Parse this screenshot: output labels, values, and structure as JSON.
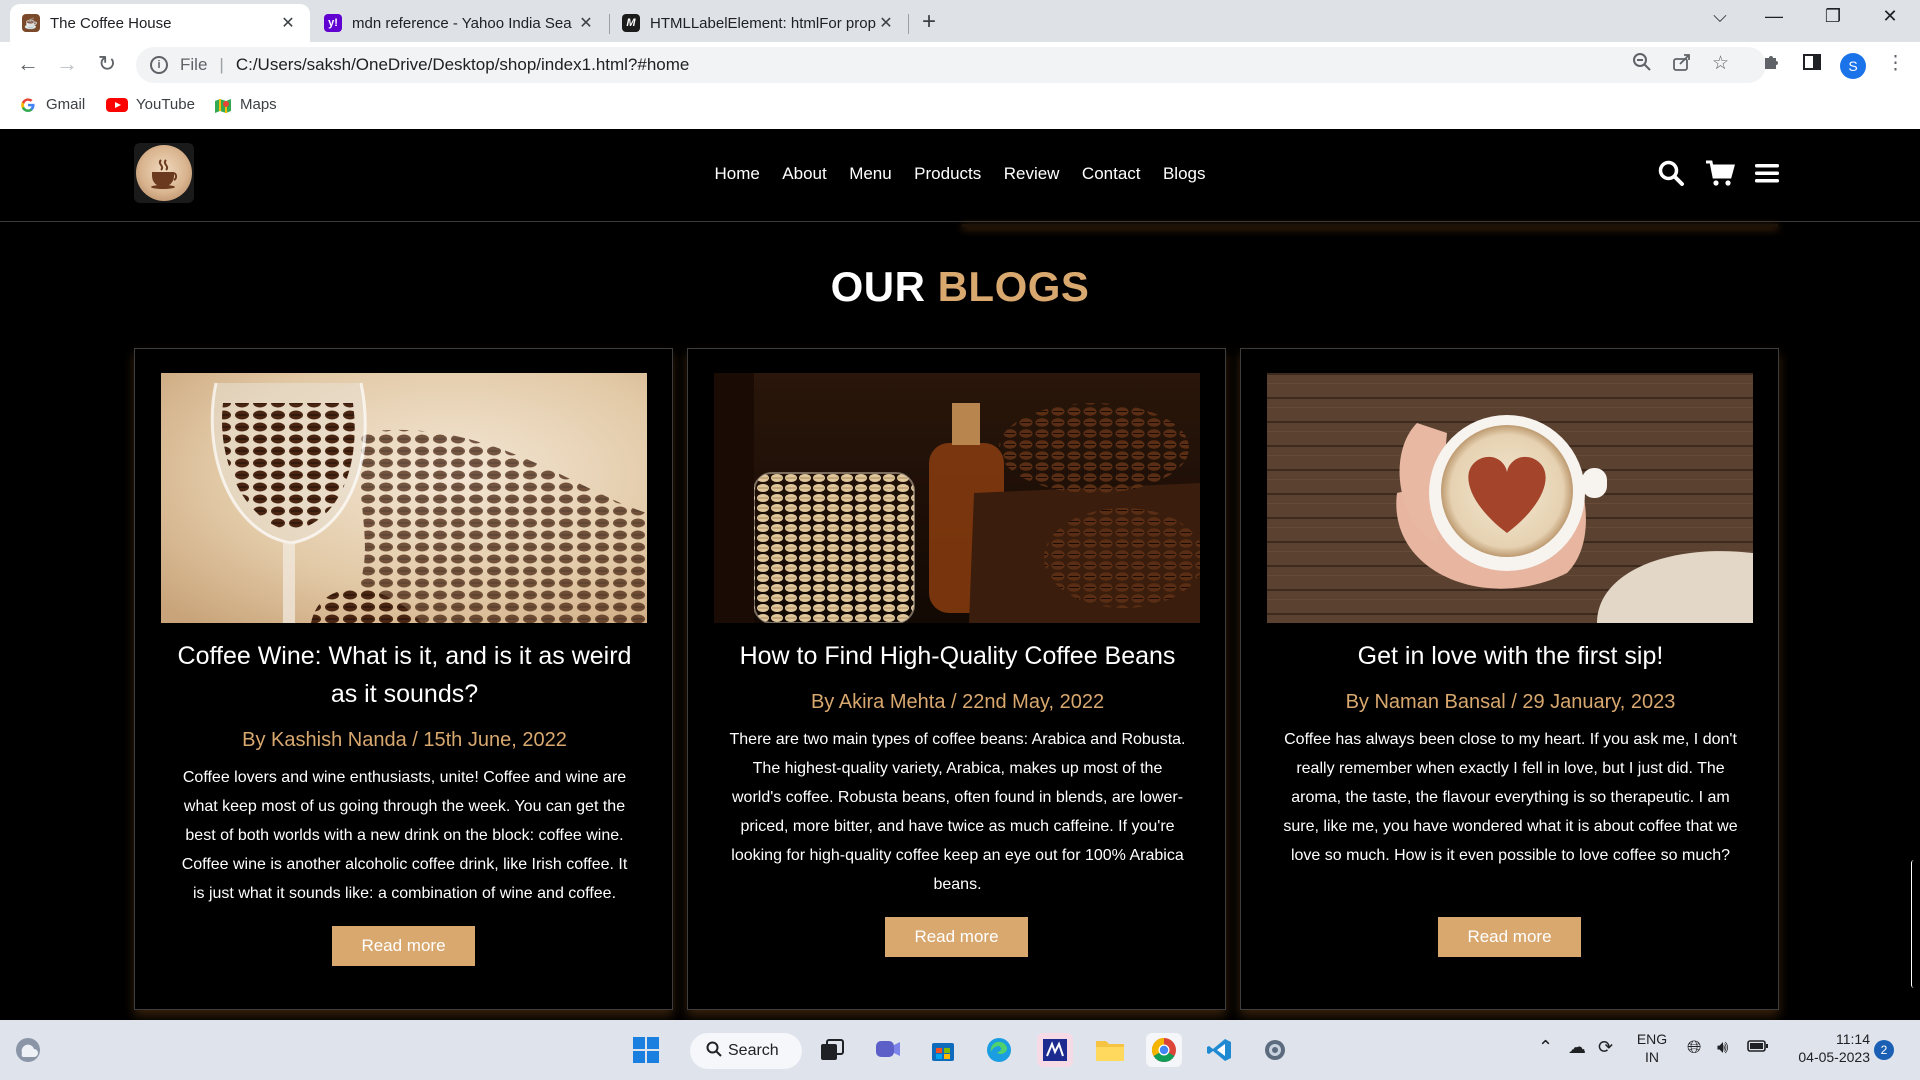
{
  "browser": {
    "tabs": [
      {
        "title": "The Coffee House",
        "active": true
      },
      {
        "title": "mdn reference - Yahoo India Sea",
        "active": false
      },
      {
        "title": "HTMLLabelElement: htmlFor prop",
        "active": false
      }
    ],
    "new_tab_icon": "plus-icon",
    "address": {
      "scheme_label": "File",
      "url": "C:/Users/saksh/OneDrive/Desktop/shop/index1.html?#home"
    },
    "profile_initial": "S",
    "bookmarks": [
      {
        "label": "Gmail",
        "icon": "google-icon"
      },
      {
        "label": "YouTube",
        "icon": "youtube-icon"
      },
      {
        "label": "Maps",
        "icon": "maps-icon"
      }
    ]
  },
  "site": {
    "nav": [
      "Home",
      "About",
      "Menu",
      "Products",
      "Review",
      "Contact",
      "Blogs"
    ],
    "heading": {
      "white": "OUR",
      "accent": "BLOGS"
    },
    "accent_color": "#d9a86f",
    "blogs": [
      {
        "title": "Coffee Wine: What is it, and is it as weird as it sounds?",
        "meta": "By Kashish Nanda / 15th June, 2022",
        "description": "Coffee lovers and wine enthusiasts, unite! Coffee and wine are what keep most of us going through the week. You can get the best of both worlds with a new drink on the block: coffee wine. Coffee wine is another alcoholic coffee drink, like Irish coffee. It is just what it sounds like: a combination of wine and coffee.",
        "button": "Read more",
        "image": "coffee-beans-in-wine-glass"
      },
      {
        "title": "How to Find High-Quality Coffee Beans",
        "meta": "By Akira Mehta / 22nd May, 2022",
        "description": "There are two main types of coffee beans: Arabica and Robusta. The highest-quality variety, Arabica, makes up most of the world's coffee. Robusta beans, often found in blends, are lower-priced, more bitter, and have twice as much caffeine. If you're looking for high-quality coffee keep an eye out for 100% Arabica beans.",
        "button": "Read more",
        "image": "coffee-beans-in-jars"
      },
      {
        "title": "Get in love with the first sip!",
        "meta": "By Naman Bansal / 29 January, 2023",
        "description": "Coffee has always been close to my heart. If you ask me, I don't really remember when exactly I fell in love, but I just did. The aroma, the taste, the flavour everything is so therapeutic. I am sure, like me, you have wondered what it is about coffee that we love so much. How is it even possible to love coffee so much?",
        "button": "Read more",
        "image": "hands-holding-heart-latte"
      }
    ]
  },
  "taskbar": {
    "search_label": "Search",
    "language": {
      "line1": "ENG",
      "line2": "IN"
    },
    "time": "11:14",
    "date": "04-05-2023",
    "notifications": "2"
  }
}
